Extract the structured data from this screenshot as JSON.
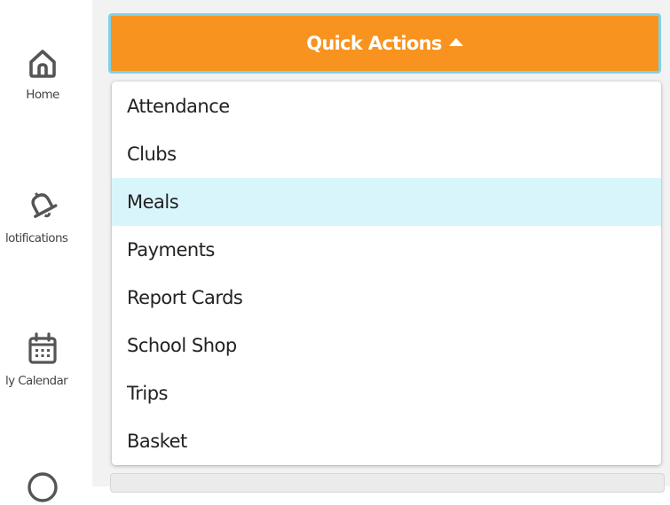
{
  "sidebar": {
    "items": [
      {
        "label": "Home",
        "icon": "home-icon"
      },
      {
        "label": "lotifications",
        "icon": "bell-icon"
      },
      {
        "label": "ly Calendar",
        "icon": "calendar-icon"
      },
      {
        "label": "",
        "icon": "circle-icon"
      }
    ]
  },
  "quick_actions": {
    "label": "Quick Actions",
    "icon": "caret-up-icon",
    "color": "#f7931e",
    "border_color": "#7fd1ea"
  },
  "menu": {
    "items": [
      {
        "label": "Attendance"
      },
      {
        "label": "Clubs"
      },
      {
        "label": "Meals",
        "highlighted": true
      },
      {
        "label": "Payments"
      },
      {
        "label": "Report Cards"
      },
      {
        "label": "School Shop"
      },
      {
        "label": "Trips"
      },
      {
        "label": "Basket"
      }
    ],
    "highlight_color": "#d9f5fc"
  }
}
